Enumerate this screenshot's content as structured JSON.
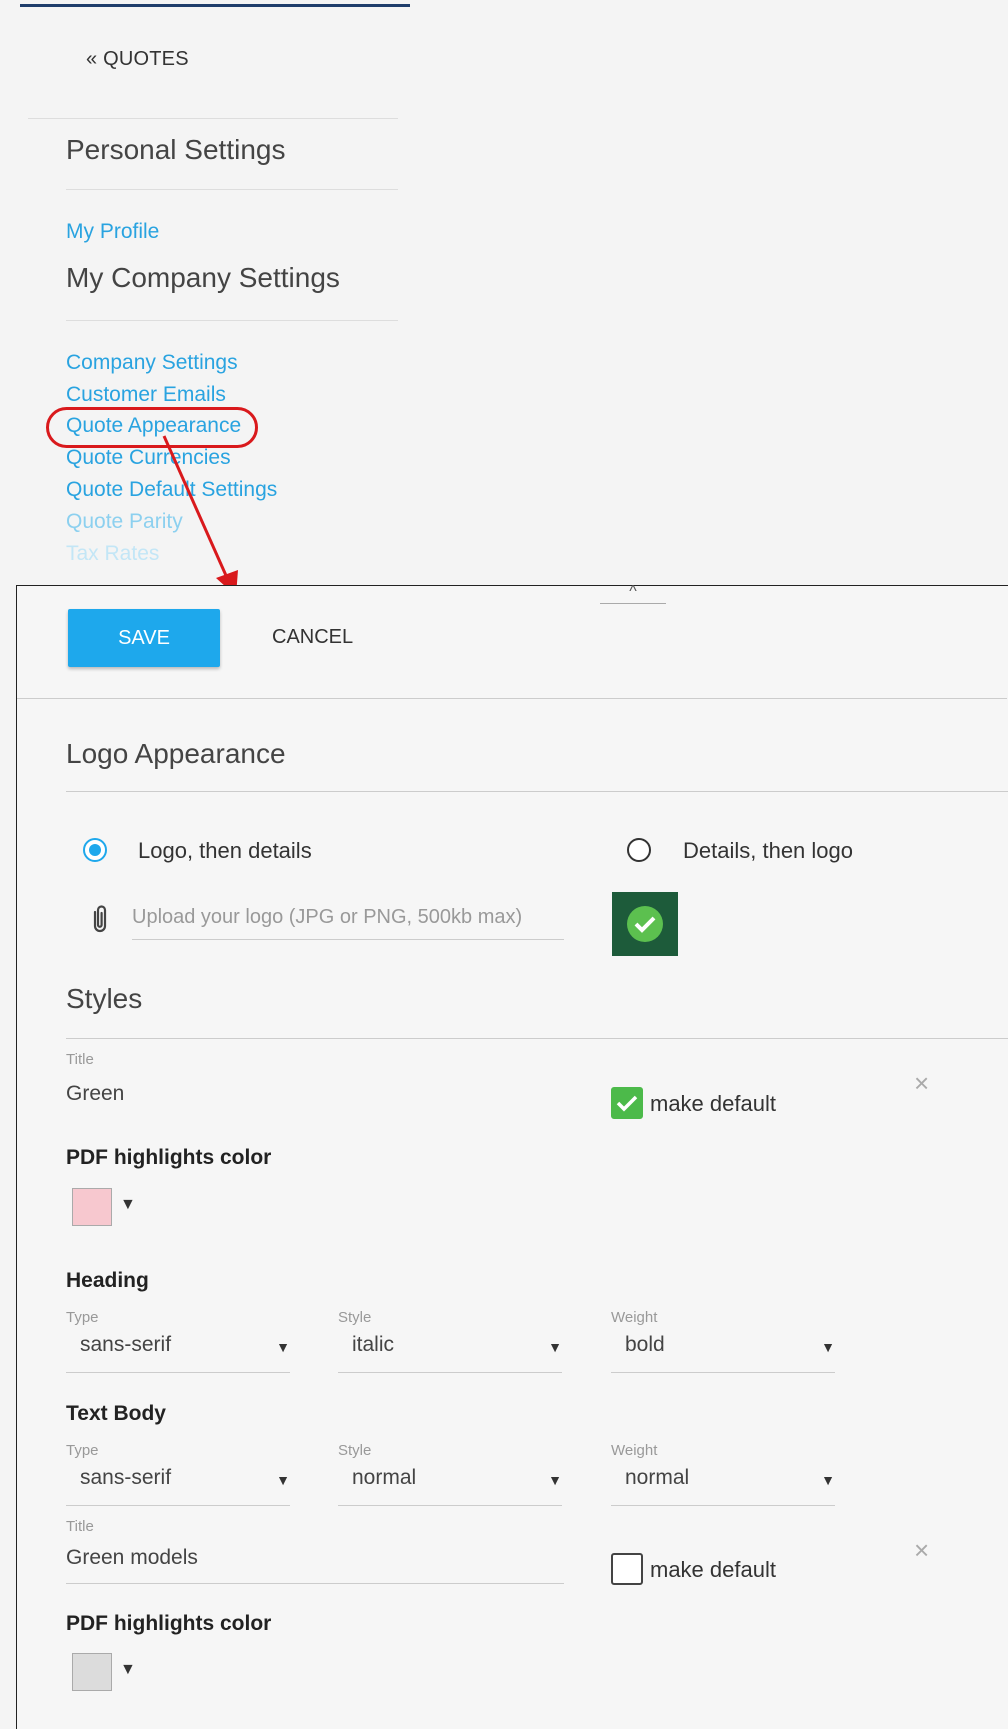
{
  "nav": {
    "back_label": "« QUOTES",
    "personal_title": "Personal Settings",
    "my_profile": "My Profile",
    "company_title": "My Company Settings",
    "links": [
      "Company Settings",
      "Customer Emails",
      "Quote Appearance",
      "Quote Currencies",
      "Quote Default Settings",
      "Quote Parity",
      "Tax Rates"
    ]
  },
  "toolbar": {
    "save_label": "SAVE",
    "cancel_label": "CANCEL",
    "collapse_glyph": "^"
  },
  "logo_appearance": {
    "heading": "Logo Appearance",
    "option_logo_first": "Logo, then details",
    "option_details_first": "Details, then logo",
    "selected": "Logo, then details",
    "upload_placeholder": "Upload your logo (JPG or PNG, 500kb max)"
  },
  "styles": {
    "heading": "Styles",
    "style1": {
      "title_label": "Title",
      "title_value": "Green",
      "make_default_label": "make default",
      "make_default_checked": true,
      "pdf_label": "PDF highlights color",
      "pdf_color": "#f7c8cf",
      "heading_label": "Heading",
      "heading_type_label": "Type",
      "heading_type": "sans-serif",
      "heading_style_label": "Style",
      "heading_style": "italic",
      "heading_weight_label": "Weight",
      "heading_weight": "bold",
      "body_label": "Text Body",
      "body_type_label": "Type",
      "body_type": "sans-serif",
      "body_style_label": "Style",
      "body_style": "normal",
      "body_weight_label": "Weight",
      "body_weight": "normal"
    },
    "style2": {
      "title_label": "Title",
      "title_value": "Green models",
      "make_default_label": "make default",
      "make_default_checked": false,
      "pdf_label": "PDF highlights color",
      "pdf_color": "#dcdcdc"
    }
  },
  "icons": {
    "close": "×",
    "caret": "▼"
  },
  "colors": {
    "accent": "#1ea8ec",
    "link": "#29a3e0",
    "annotation": "#d9191c",
    "check": "#4cba4a"
  }
}
